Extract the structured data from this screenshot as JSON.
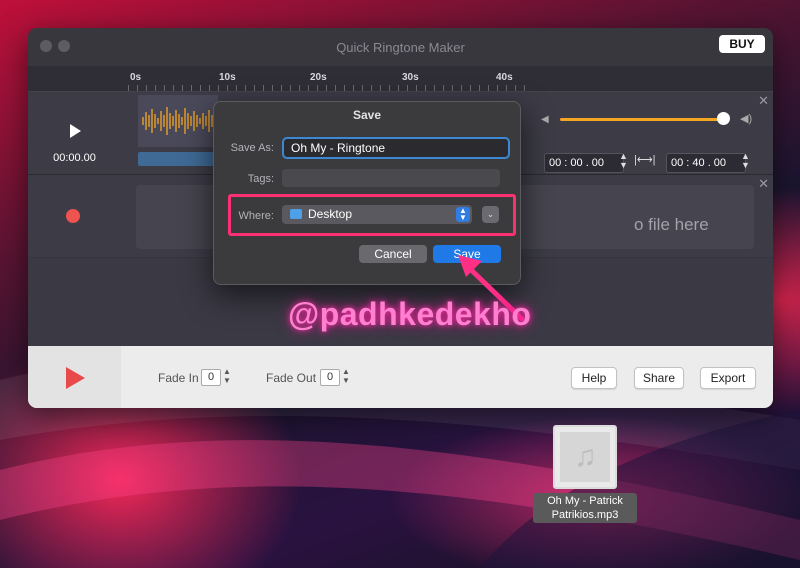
{
  "window": {
    "title": "Quick Ringtone Maker",
    "buy_label": "BUY"
  },
  "ruler": {
    "labels": [
      "0s",
      "10s",
      "20s",
      "30s",
      "40s"
    ]
  },
  "track1": {
    "time": "00:00.00",
    "start_time": "00 : 00 . 00",
    "end_time": "00 : 40 . 00",
    "volume_level": 0.95
  },
  "track2": {
    "drop_text": "o file here"
  },
  "bottom": {
    "fade_in_label": "Fade In",
    "fade_in_value": "0",
    "fade_out_label": "Fade Out",
    "fade_out_value": "0",
    "help_label": "Help",
    "share_label": "Share",
    "export_label": "Export"
  },
  "dialog": {
    "title": "Save",
    "save_as_label": "Save As:",
    "save_as_value": "Oh My - Ringtone",
    "tags_label": "Tags:",
    "where_label": "Where:",
    "where_value": "Desktop",
    "cancel_label": "Cancel",
    "save_label": "Save"
  },
  "watermark": "@padhkedekho",
  "desktop_file": {
    "line1": "Oh My - Patrick",
    "line2": "Patrikios.mp3"
  },
  "colors": {
    "accent": "#1f7ae8",
    "highlight": "#ff2f73",
    "waveform": "#f5a623"
  }
}
